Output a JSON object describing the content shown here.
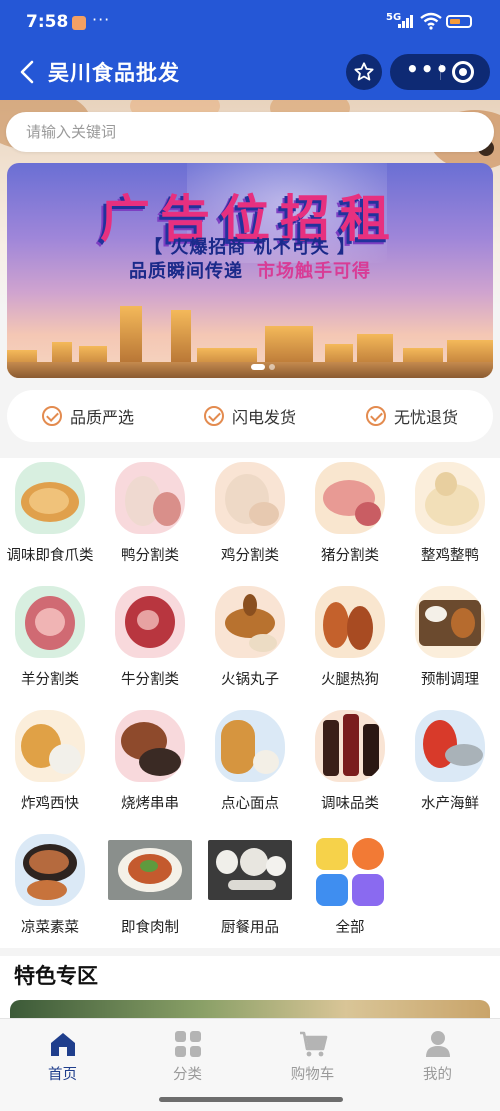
{
  "status": {
    "time": "7:58",
    "signal": "5G"
  },
  "header": {
    "title": "吴川食品批发"
  },
  "search": {
    "placeholder": "请输入关键词"
  },
  "banner": {
    "headline": "广告位招租",
    "line1": "【 火爆招商  机不可失 】",
    "line2a": "品质瞬间传递",
    "line2b": "市场触手可得"
  },
  "services": [
    {
      "label": "品质严选"
    },
    {
      "label": "闪电发货"
    },
    {
      "label": "无忧退货"
    }
  ],
  "categories": [
    {
      "label": "调味即食爪类",
      "icon": "chicken-feet-icon"
    },
    {
      "label": "鸭分割类",
      "icon": "duck-parts-icon"
    },
    {
      "label": "鸡分割类",
      "icon": "chicken-parts-icon"
    },
    {
      "label": "猪分割类",
      "icon": "pork-parts-icon"
    },
    {
      "label": "整鸡整鸭",
      "icon": "whole-chicken-icon"
    },
    {
      "label": "羊分割类",
      "icon": "lamb-parts-icon"
    },
    {
      "label": "牛分割类",
      "icon": "beef-parts-icon"
    },
    {
      "label": "火锅丸子",
      "icon": "hotpot-icon"
    },
    {
      "label": "火腿热狗",
      "icon": "sausage-icon"
    },
    {
      "label": "预制调理",
      "icon": "prepared-meal-icon"
    },
    {
      "label": "炸鸡西快",
      "icon": "fried-chicken-icon"
    },
    {
      "label": "烧烤串串",
      "icon": "bbq-skewers-icon"
    },
    {
      "label": "点心面点",
      "icon": "dim-sum-icon"
    },
    {
      "label": "调味品类",
      "icon": "condiments-icon"
    },
    {
      "label": "水产海鲜",
      "icon": "seafood-icon"
    },
    {
      "label": "凉菜素菜",
      "icon": "cold-dish-icon"
    },
    {
      "label": "即食肉制",
      "icon": "ready-meat-icon"
    },
    {
      "label": "厨餐用品",
      "icon": "tableware-icon"
    },
    {
      "label": "全部",
      "icon": "all-categories-icon"
    }
  ],
  "special": {
    "title": "特色专区"
  },
  "tabs": [
    {
      "label": "首页",
      "icon": "home-icon",
      "active": true
    },
    {
      "label": "分类",
      "icon": "category-icon",
      "active": false
    },
    {
      "label": "购物车",
      "icon": "cart-icon",
      "active": false
    },
    {
      "label": "我的",
      "icon": "profile-icon",
      "active": false
    }
  ],
  "colors": {
    "brand_blue": "#2557d6",
    "capsule": "#0e2a74",
    "accent_orange": "#e38b4f",
    "tab_active": "#1f3e8c",
    "tab_inactive": "#9a9a9a"
  }
}
